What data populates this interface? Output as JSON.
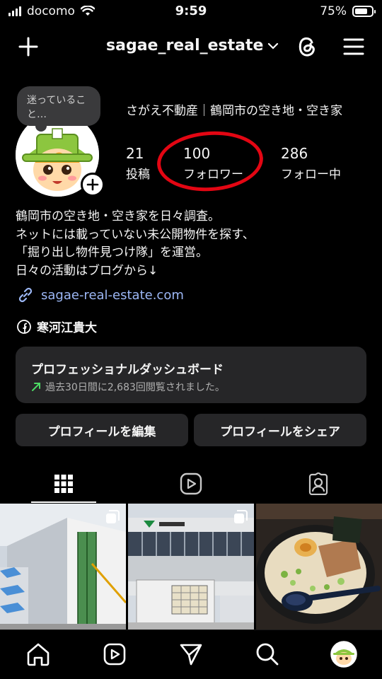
{
  "status": {
    "carrier": "docomo",
    "time": "9:59",
    "battery": "75%",
    "battery_level": 0.75
  },
  "header": {
    "username": "sagae_real_estate"
  },
  "profile": {
    "note_bubble": "迷っていること…",
    "display_name": "さがえ不動産｜鶴岡市の空き地・空き家",
    "stats": [
      {
        "num": "21",
        "label": "投稿"
      },
      {
        "num": "100",
        "label": "フォロワー"
      },
      {
        "num": "286",
        "label": "フォロー中"
      }
    ],
    "bio": [
      "鶴岡市の空き地・空き家を日々調査。",
      "ネットには載っていない未公開物件を探す、",
      "「掘り出し物件見つけ隊」を運営。",
      "日々の活動はブログから↓"
    ],
    "link": "sagae-real-estate.com",
    "facebook_name": "寒河江貴大"
  },
  "dashboard": {
    "title": "プロフェッショナルダッシュボード",
    "subtitle": "過去30日間に2,683回閲覧されました。"
  },
  "buttons": {
    "edit": "プロフィールを編集",
    "share": "プロフィールをシェア"
  },
  "tabs": [
    "grid-icon",
    "reels-icon",
    "tagged-icon"
  ],
  "nav": [
    "home-icon",
    "reels-icon",
    "send-icon",
    "search-icon",
    "profile-avatar"
  ],
  "colors": {
    "background": "#000000",
    "card": "#262628",
    "link": "#9cb7f5",
    "highlight": "#e30613",
    "trend": "#4cd964"
  }
}
